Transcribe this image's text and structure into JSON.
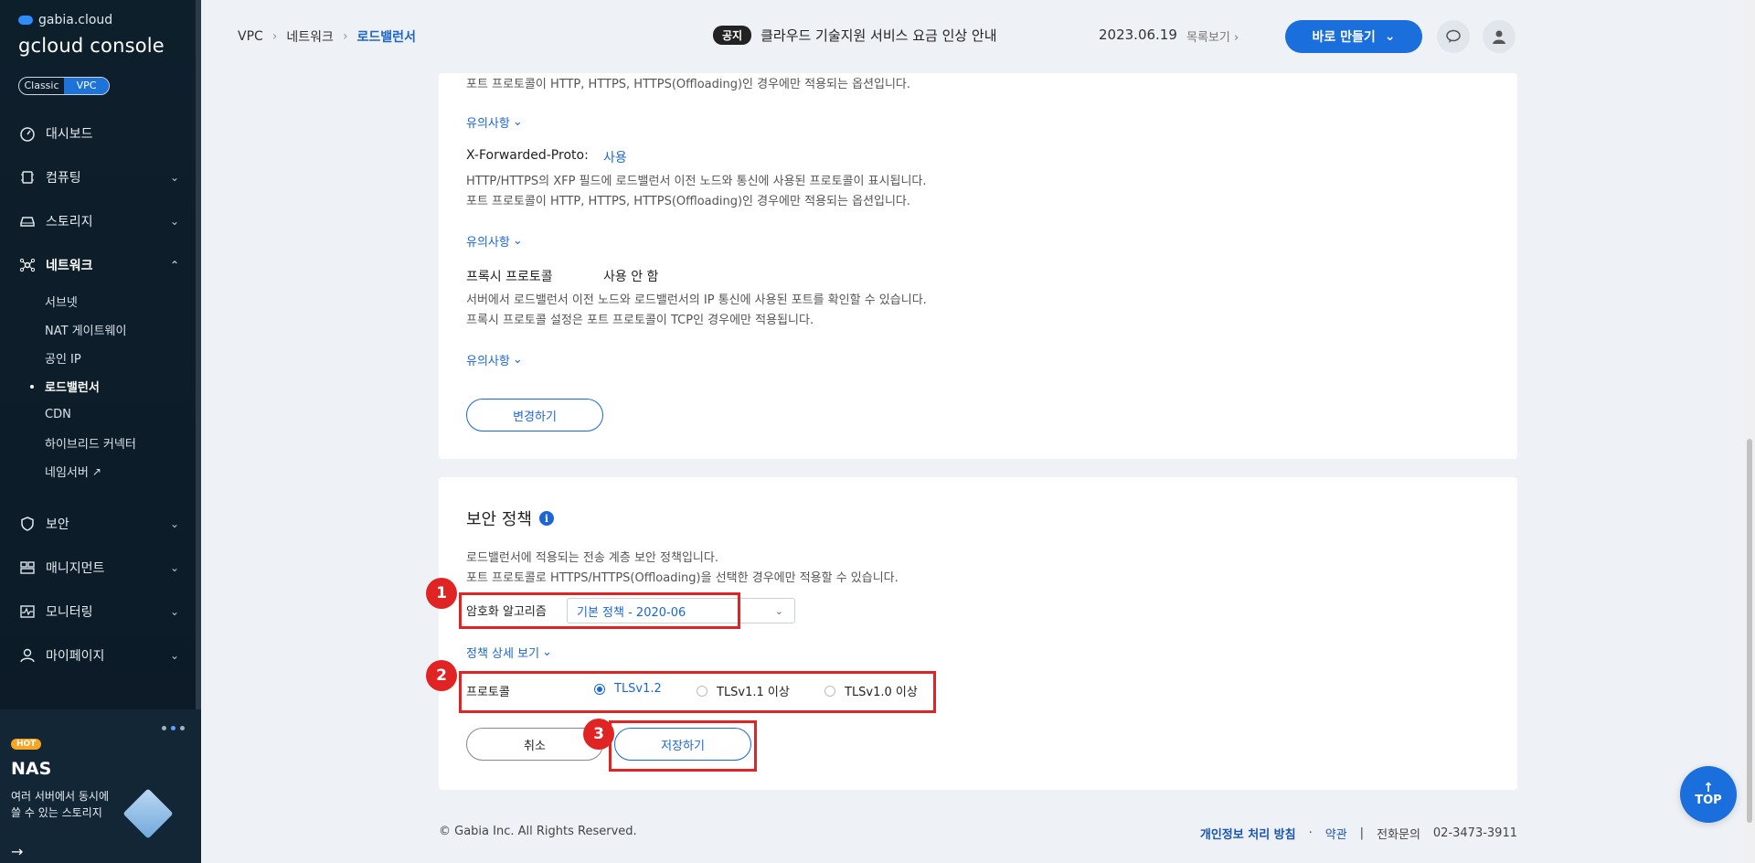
{
  "sidebar": {
    "brand_top": "gabia.cloud",
    "brand_main": "gcloud console",
    "toggle": {
      "classic": "Classic",
      "vpc": "VPC"
    },
    "items": [
      {
        "label": "대시보드",
        "icon": "dashboard-icon"
      },
      {
        "label": "컴퓨팅",
        "icon": "chip-icon"
      },
      {
        "label": "스토리지",
        "icon": "storage-icon"
      },
      {
        "label": "네트워크",
        "icon": "network-icon"
      },
      {
        "label": "보안",
        "icon": "shield-icon"
      },
      {
        "label": "매니지먼트",
        "icon": "management-icon"
      },
      {
        "label": "모니터링",
        "icon": "monitor-icon"
      },
      {
        "label": "마이페이지",
        "icon": "user-icon"
      }
    ],
    "network_sub": [
      "서브넷",
      "NAT 게이트웨이",
      "공인 IP",
      "로드밸런서",
      "CDN",
      "하이브리드 커넥터",
      "네임서버"
    ],
    "promo": {
      "hot": "HOT",
      "title": "NAS",
      "desc": "여러 서버에서 동시에 쓸 수 있는 스토리지"
    }
  },
  "header": {
    "breadcrumb": [
      "VPC",
      "네트워크",
      "로드밸런서"
    ],
    "notice_badge": "공지",
    "notice_text": "클라우드 기술지원 서비스 요금 인상 안내",
    "notice_date": "2023.06.19",
    "notice_list": "목록보기",
    "create_button": "바로 만들기"
  },
  "panel1": {
    "line_top": "포트 프로토콜이 HTTP, HTTPS, HTTPS(Offloading)인 경우에만 적용되는 옵션입니다.",
    "caution": "유의사항",
    "xfp_label": "X-Forwarded-Proto:",
    "xfp_value": "사용",
    "xfp_desc1": "HTTP/HTTPS의 XFP 필드에 로드밸런서 이전 노드와 통신에 사용된 프로토콜이 표시됩니다.",
    "xfp_desc2": "포트 프로토콜이 HTTP, HTTPS, HTTPS(Offloading)인 경우에만 적용되는 옵션입니다.",
    "proxy_label": "프록시 프로토콜",
    "proxy_value": "사용 안 함",
    "proxy_desc1": "서버에서 로드밸런서 이전 노드와 로드밸런서의 IP 통신에 사용된 포트를 확인할 수 있습니다.",
    "proxy_desc2": "프록시 프로토콜 설정은 포트 프로토콜이 TCP인 경우에만 적용됩니다.",
    "change_button": "변경하기"
  },
  "security": {
    "title": "보안 정책",
    "desc1": "로드밸런서에 적용되는 전송 계층 보안 정책입니다.",
    "desc2": "포트 프로토콜로 HTTPS/HTTPS(Offloading)을 선택한 경우에만 적용할 수 있습니다.",
    "cipher_label": "암호화 알고리즘",
    "cipher_value": "기본 정책 - 2020-06",
    "detail_link": "정책 상세 보기",
    "protocol_label": "프로토콜",
    "protocol_options": [
      "TLSv1.2",
      "TLSv1.1 이상",
      "TLSv1.0 이상"
    ],
    "protocol_selected": "TLSv1.2",
    "cancel_button": "취소",
    "save_button": "저장하기",
    "markers": [
      "1",
      "2",
      "3"
    ],
    "highlight_color": "#e02424"
  },
  "footer": {
    "copyright": "© Gabia Inc. All Rights Reserved.",
    "privacy": "개인정보 처리 방침",
    "dot": "·",
    "terms": "약관",
    "bar": "|",
    "contact_label": "전화문의",
    "contact_number": "02-3473-3911"
  },
  "top_button": "TOP",
  "accent_color": "#1a6fdd"
}
